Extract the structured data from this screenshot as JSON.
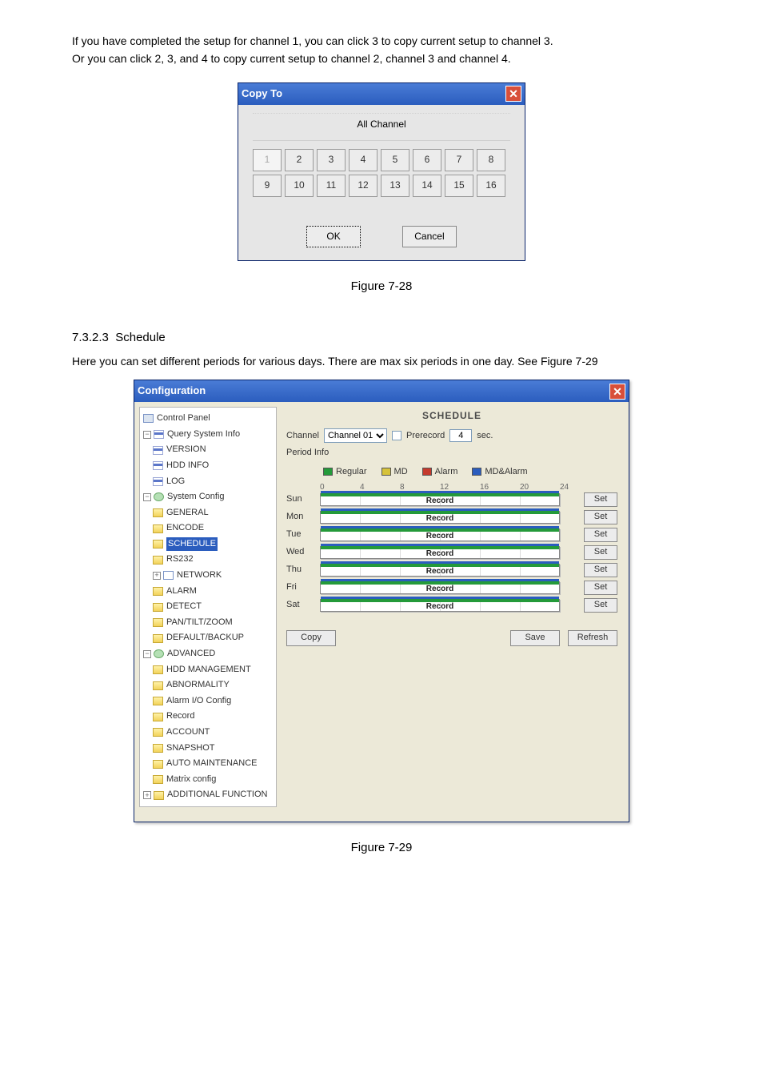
{
  "intro": {
    "line1": "If you have completed the setup for channel 1, you can click 3 to copy current setup to channel 3.",
    "line2": "Or you can click 2, 3, and 4 to copy current setup to channel 2, channel 3 and channel 4."
  },
  "copy_dialog": {
    "title": "Copy To",
    "all_channel": "All Channel",
    "channels": [
      "1",
      "2",
      "3",
      "4",
      "5",
      "6",
      "7",
      "8",
      "9",
      "10",
      "11",
      "12",
      "13",
      "14",
      "15",
      "16"
    ],
    "disabled_channel": "1",
    "ok": "OK",
    "cancel": "Cancel"
  },
  "figure1": "Figure 7-28",
  "section": {
    "num": "7.3.2.3",
    "title": "Schedule",
    "body": "Here you can set different periods for various days. There are max six periods in one day. See Figure 7-29"
  },
  "config": {
    "title": "Configuration",
    "tree": {
      "control_panel": "Control Panel",
      "query": "Query System Info",
      "version": "VERSION",
      "hdd_info": "HDD INFO",
      "log": "LOG",
      "system_config": "System Config",
      "general": "GENERAL",
      "encode": "ENCODE",
      "schedule": "SCHEDULE",
      "rs232": "RS232",
      "network": "NETWORK",
      "alarm": "ALARM",
      "detect": "DETECT",
      "ptz": "PAN/TILT/ZOOM",
      "default": "DEFAULT/BACKUP",
      "advanced": "ADVANCED",
      "hdd_mgmt": "HDD MANAGEMENT",
      "abnormality": "ABNORMALITY",
      "alarm_io": "Alarm I/O Config",
      "record": "Record",
      "account": "ACCOUNT",
      "snapshot": "SNAPSHOT",
      "auto_maint": "AUTO MAINTENANCE",
      "matrix": "Matrix config",
      "additional": "ADDITIONAL FUNCTION"
    },
    "panel": {
      "heading": "SCHEDULE",
      "channel_label": "Channel",
      "channel_value": "Channel 01",
      "prerecord_label": "Prerecord",
      "prerecord_value": "4",
      "sec": "sec.",
      "period_info": "Period Info",
      "legend": {
        "regular": "Regular",
        "md": "MD",
        "alarm": "Alarm",
        "mdalarm": "MD&Alarm"
      },
      "ticks": [
        "0",
        "4",
        "8",
        "12",
        "16",
        "20",
        "24"
      ],
      "days": [
        "Sun",
        "Mon",
        "Tue",
        "Wed",
        "Thu",
        "Fri",
        "Sat"
      ],
      "record": "Record",
      "set": "Set",
      "copy": "Copy",
      "save": "Save",
      "refresh": "Refresh"
    }
  },
  "figure2": "Figure 7-29"
}
